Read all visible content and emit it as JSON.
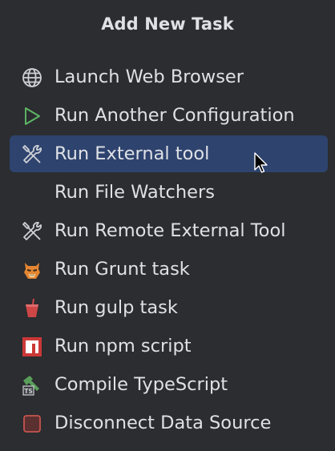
{
  "popup": {
    "title": "Add New Task",
    "items": [
      {
        "label": "Launch Web Browser",
        "icon": "globe-icon",
        "selected": false
      },
      {
        "label": "Run Another Configuration",
        "icon": "play-icon",
        "selected": false
      },
      {
        "label": "Run External tool",
        "icon": "tools-icon",
        "selected": true
      },
      {
        "label": "Run File Watchers",
        "icon": "",
        "selected": false
      },
      {
        "label": "Run Remote External Tool",
        "icon": "tools-icon",
        "selected": false
      },
      {
        "label": "Run Grunt task",
        "icon": "grunt-icon",
        "selected": false
      },
      {
        "label": "Run gulp task",
        "icon": "gulp-icon",
        "selected": false
      },
      {
        "label": "Run npm script",
        "icon": "npm-icon",
        "selected": false
      },
      {
        "label": "Compile TypeScript",
        "icon": "typescript-icon",
        "selected": false
      },
      {
        "label": "Disconnect Data Source",
        "icon": "stop-icon",
        "selected": false
      }
    ]
  },
  "colors": {
    "background": "#2b2d30",
    "selection": "#2e436e",
    "text": "#dfe1e5",
    "play_green": "#5fb865",
    "npm_red": "#cb3837",
    "gulp_red": "#cf4647",
    "stop_red": "#c75450"
  }
}
